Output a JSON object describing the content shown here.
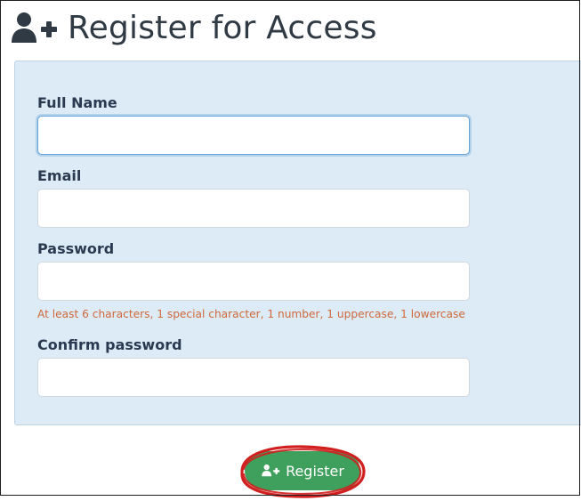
{
  "header": {
    "title": "Register for Access",
    "icon": "user-plus-icon"
  },
  "form": {
    "full_name": {
      "label": "Full Name",
      "value": "",
      "placeholder": ""
    },
    "email": {
      "label": "Email",
      "value": "",
      "placeholder": ""
    },
    "password": {
      "label": "Password",
      "value": "",
      "placeholder": "",
      "hint": "At least 6 characters, 1 special character, 1 number, 1 uppercase, 1 lowercase"
    },
    "confirm_password": {
      "label": "Confirm password",
      "value": "",
      "placeholder": ""
    }
  },
  "actions": {
    "register_label": "Register",
    "register_icon": "user-plus-icon"
  },
  "colors": {
    "panel_bg": "#dcebf6",
    "label_text": "#2b3a50",
    "hint_text": "#d0683c",
    "button_bg": "#3f9f5c",
    "annotation_red": "#d11f1f"
  }
}
